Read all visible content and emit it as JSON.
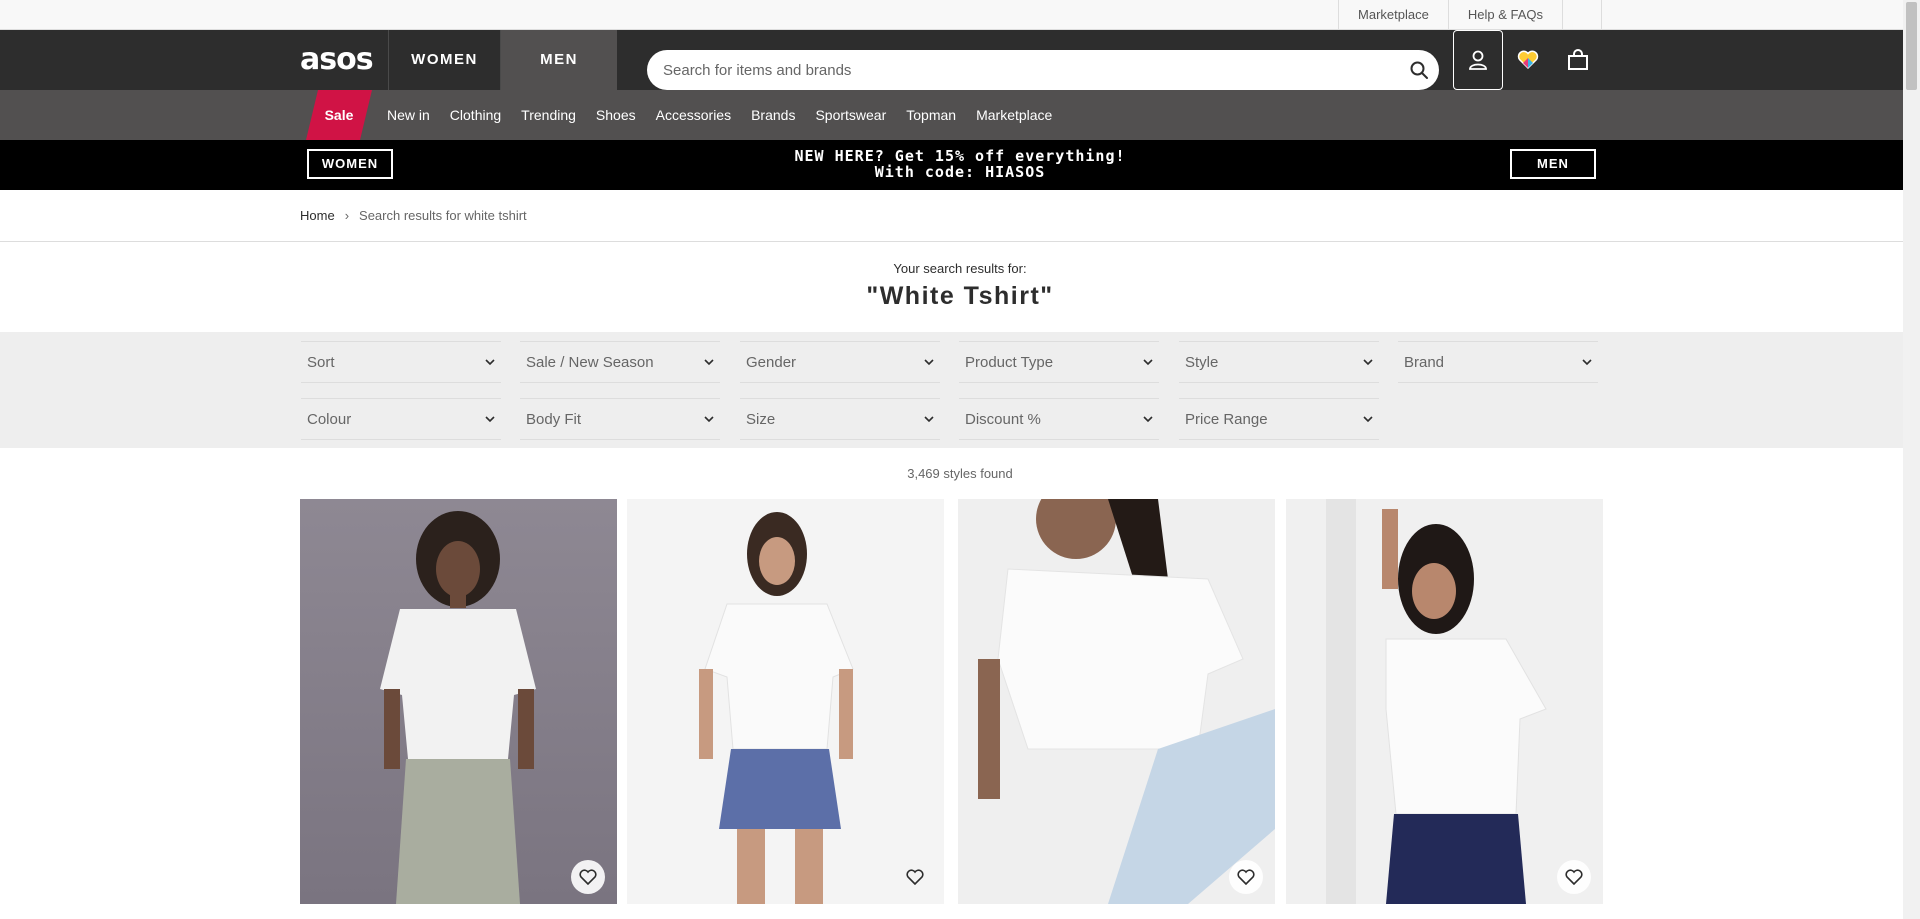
{
  "util": {
    "links": [
      "Marketplace",
      "Help & FAQs"
    ],
    "flag_icon": "us-flag-icon"
  },
  "header": {
    "logo": "asos",
    "tabs": [
      "WOMEN",
      "MEN"
    ],
    "search_placeholder": "Search for items and brands",
    "icons": [
      "search-icon",
      "account-icon",
      "saved-heart-icon",
      "bag-icon"
    ]
  },
  "nav": {
    "sale": "Sale",
    "items": [
      "New in",
      "Clothing",
      "Trending",
      "Shoes",
      "Accessories",
      "Brands",
      "Sportswear",
      "Topman",
      "Marketplace"
    ]
  },
  "promo": {
    "women": "WOMEN",
    "men": "MEN",
    "line1": "NEW HERE? Get 15% off everything!",
    "line2": "With code: HIASOS"
  },
  "breadcrumb": {
    "home": "Home",
    "separator": "›",
    "current": "Search results for white tshirt"
  },
  "results": {
    "pre": "Your search results for:",
    "term": "\"White Tshirt\"",
    "count": "3,469 styles found"
  },
  "filters": {
    "row1": [
      "Sort",
      "Sale / New Season",
      "Gender",
      "Product Type",
      "Style",
      "Brand"
    ],
    "row2": [
      "Colour",
      "Body Fit",
      "Size",
      "Discount %",
      "Price Range"
    ]
  },
  "colors": {
    "header_bg": "#2d2d2d",
    "nav_bg": "#525050",
    "sale_red": "#d01345",
    "promo_bg": "#000000",
    "filter_bg": "#eeeeee"
  }
}
